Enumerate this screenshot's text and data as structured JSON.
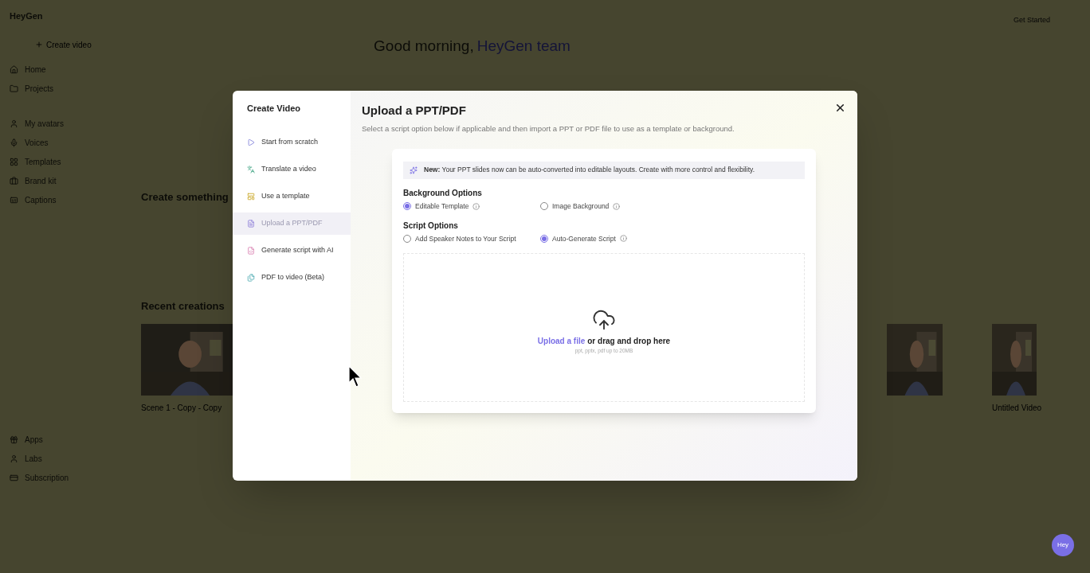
{
  "app": {
    "logo": "HeyGen",
    "create_button": "Create video",
    "nav": [
      {
        "label": "Home"
      },
      {
        "label": "Projects"
      },
      {
        "label": "My avatars"
      },
      {
        "label": "Voices"
      },
      {
        "label": "Templates"
      },
      {
        "label": "Brand kit"
      },
      {
        "label": "Captions"
      }
    ],
    "bottom_nav": [
      {
        "label": "Apps"
      },
      {
        "label": "Labs"
      },
      {
        "label": "Subscription"
      }
    ],
    "greeting": "Good morning,",
    "greeting_name": "HeyGen team",
    "get_started": "Get Started",
    "create_heading": "Create something",
    "recent_heading": "Recent creations",
    "recent": [
      {
        "title": "Scene 1 - Copy - Copy"
      },
      {
        "title": "Untitled Video"
      }
    ],
    "chat_button": "Hey"
  },
  "modal": {
    "sidebar_title": "Create Video",
    "options": [
      {
        "label": "Start from scratch",
        "selected": false
      },
      {
        "label": "Translate a video",
        "selected": false
      },
      {
        "label": "Use a template",
        "selected": false
      },
      {
        "label": "Upload a PPT/PDF",
        "selected": true
      },
      {
        "label": "Generate script with AI",
        "selected": false
      },
      {
        "label": "PDF to video (Beta)",
        "selected": false
      }
    ],
    "title": "Upload a PPT/PDF",
    "subtitle": "Select a script option below if applicable and then import a PPT or PDF file to use as a template or background.",
    "notice": "**New:** Your PPT slides now can be auto-converted into editable layouts. Create with more control and flexibility.",
    "groups": [
      {
        "heading": "Background Options",
        "choices": [
          {
            "label": "Editable Template",
            "selected": true,
            "info": true
          },
          {
            "label": "Image Background",
            "selected": false,
            "info": true
          }
        ]
      },
      {
        "heading": "Script Options",
        "choices": [
          {
            "label": "Add Speaker Notes to Your Script",
            "selected": false,
            "info": false
          },
          {
            "label": "Auto-Generate Script",
            "selected": true,
            "info": true
          }
        ]
      }
    ],
    "upload_link": "Upload a file",
    "upload_text": "or drag and drop here",
    "upload_hint": "ppt, pptx, pdf up to 20MB"
  }
}
